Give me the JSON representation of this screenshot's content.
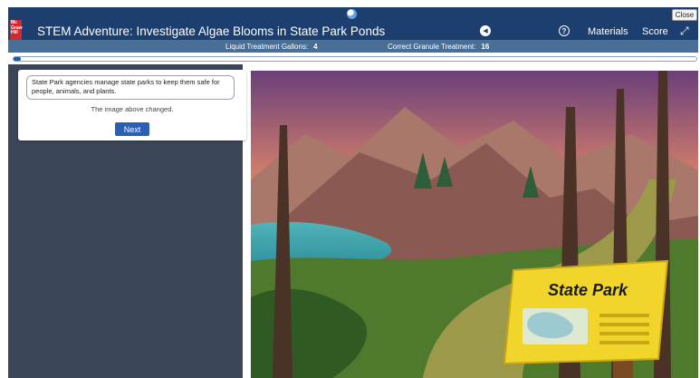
{
  "window": {
    "close_label": "Close"
  },
  "header": {
    "logo_text": "Mc Graw Hill",
    "title": "STEM Adventure: Investigate Algae Blooms in State Park Ponds",
    "materials_label": "Materials",
    "score_label": "Score"
  },
  "status": {
    "liquid_label": "Liquid Treatment Gallons:",
    "liquid_value": "4",
    "granule_label": "Correct Granule Treatment:",
    "granule_value": "16"
  },
  "progress": {
    "fraction": 0.005
  },
  "panel": {
    "message": "State Park agencies manage state parks to keep them safe for people, animals, and plants.",
    "note": "The image above changed.",
    "next_label": "Next"
  },
  "scene": {
    "sign_text": "State Park"
  },
  "icons": {
    "globe": "globe-icon",
    "audio": "audio-icon",
    "help": "help-icon",
    "expand": "expand-icon"
  },
  "colors": {
    "header_bg": "#1c3f70",
    "status_bg": "#4a6f96",
    "left_pane_bg": "#3b4659",
    "button_blue": "#2b5fb3",
    "logo_red": "#d9262c",
    "sign_yellow": "#f2d52b"
  }
}
